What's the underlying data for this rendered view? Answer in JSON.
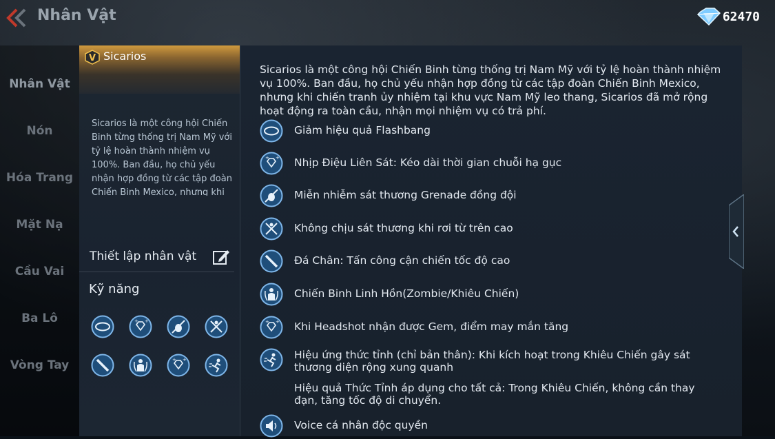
{
  "header": {
    "title": "Nhân Vật",
    "gems": "62470"
  },
  "nav": {
    "items": [
      {
        "label": "Nhân Vật",
        "active": true
      },
      {
        "label": "Nón"
      },
      {
        "label": "Hóa Trang"
      },
      {
        "label": "Mặt Nạ"
      },
      {
        "label": "Cầu Vai"
      },
      {
        "label": "Ba Lô"
      },
      {
        "label": "Vòng Tay"
      }
    ]
  },
  "character": {
    "name": "Sicarios",
    "badge": "V",
    "short_desc": "Sicarios là một công hội Chiến Binh từng thống trị Nam Mỹ với tỷ lệ hoàn thành nhiệm vụ 100%. Ban đầu, họ chủ yếu nhận hợp đồng từ các tập đoàn Chiến Binh Mexico, nhưng khi chiến tranh",
    "setup_label": "Thiết lập nhân vật",
    "skills_title": "Kỹ năng",
    "skill_icons": [
      "goggles-icon",
      "gem-icon",
      "grenade-ban-icon",
      "fall-ban-icon",
      "knife-icon",
      "spirit-icon",
      "gem-icon",
      "runner-icon"
    ]
  },
  "details": {
    "intro": "Sicarios là một công hội Chiến Binh từng thống trị Nam Mỹ với tỷ lệ hoàn thành nhiệm vụ 100%. Ban đầu, họ chủ yếu nhận hợp đồng từ các tập đoàn Chiến Binh Mexico, nhưng khi chiến tranh ủy nhiệm tại khu vực Nam Mỹ leo thang, Sicarios đã mở rộng hoạt động ra toàn cầu, nhận mọi nhiệm vụ có trả phí.",
    "abilities": [
      {
        "icon": "goggles-icon",
        "text": "Giảm hiệu quả Flashbang"
      },
      {
        "icon": "gem-icon",
        "text": "Nhịp Điệu Liên Sát: Kéo dài thời gian chuỗi hạ gục"
      },
      {
        "icon": "grenade-ban-icon",
        "text": "Miễn nhiễm sát thương Grenade đồng đội"
      },
      {
        "icon": "fall-ban-icon",
        "text": "Không chịu sát thương khi rơi từ trên cao"
      },
      {
        "icon": "knife-icon",
        "text": "Đá Chân: Tấn công cận chiến tốc độ cao"
      },
      {
        "icon": "spirit-icon",
        "text": "Chiến Binh Linh Hồn(Zombie/Khiêu Chiến)"
      },
      {
        "icon": "gem-icon",
        "text": "Khi Headshot nhận được Gem, điểm may mắn tăng"
      },
      {
        "icon": "runner-icon",
        "text": "Hiệu ứng thức tỉnh (chỉ bản thân): Khi kích hoạt trong Khiêu Chiến gây sát thương diện rộng xung quanh"
      },
      {
        "icon": "voice-icon",
        "text": "Voice cá nhân độc quyền"
      }
    ],
    "awaken_note": "Hiệu quả Thức Tỉnh áp dụng cho tất cả: Trong Khiêu Chiến, không cần thay đạn, tăng tốc độ di chuyển."
  },
  "colors": {
    "accent_gold": "#d09a3e",
    "icon_blue": "#7fb7ea",
    "icon_fill": "#1f4e7a"
  }
}
